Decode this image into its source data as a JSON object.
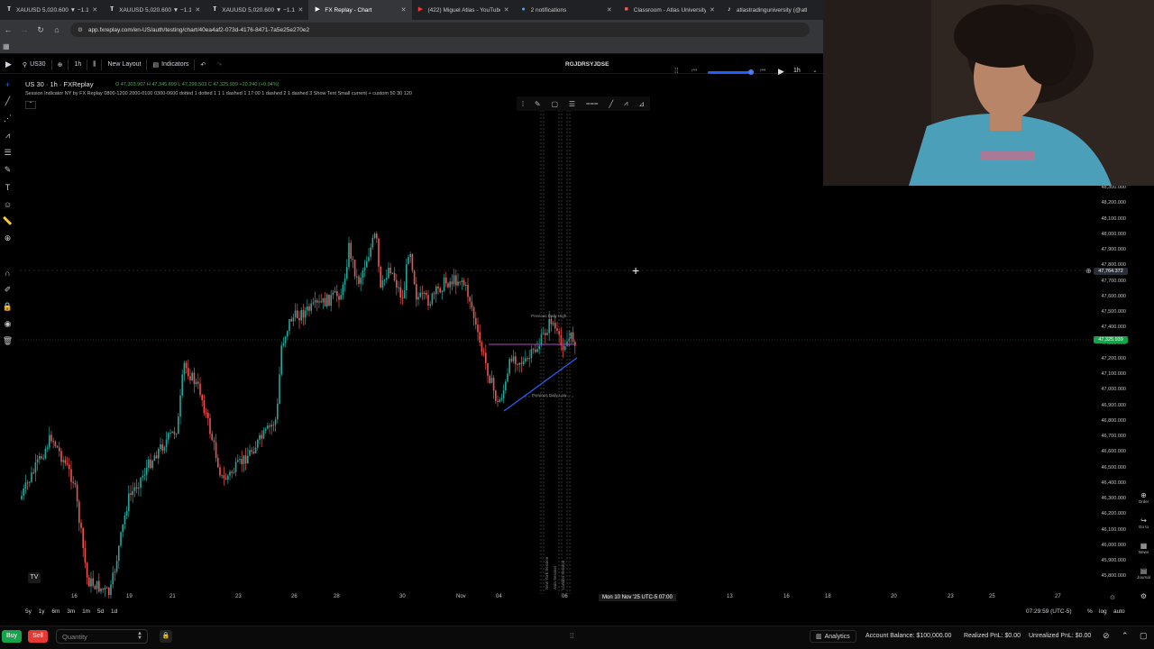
{
  "browser": {
    "tabs": [
      {
        "label": "XAUUSD 5,020.600 ▼ −1.15",
        "favicon": "tradingview-icon",
        "active": false
      },
      {
        "label": "XAUUSD 5,020.600 ▼ −1.15",
        "favicon": "tradingview-icon",
        "active": false
      },
      {
        "label": "XAUUSD 5,020.600 ▼ −1.15",
        "favicon": "tradingview-icon",
        "active": false
      },
      {
        "label": "FX Replay - Chart",
        "favicon": "fxreplay-icon",
        "active": true
      },
      {
        "label": "(422) Miguel Atlas - YouTube",
        "favicon": "youtube-icon",
        "active": false
      },
      {
        "label": "2 notifications",
        "favicon": "notification-icon",
        "active": false
      },
      {
        "label": "Classroom - Atlas University",
        "favicon": "classroom-icon",
        "active": false
      },
      {
        "label": "atlastradinguniversity (@atl",
        "favicon": "tiktok-icon",
        "active": false
      }
    ],
    "url": "app.fxreplay.com/en-US/auth/testing/chart/40ea4af2-073d-4176-8471-7a5e25e270e2"
  },
  "toolbar": {
    "symbol": "US30",
    "timeframe": "1h",
    "new_layout": "New Layout",
    "indicators": "Indicators",
    "center_code": "RGJDRSYJDSE",
    "replay_timeframe": "1h"
  },
  "legend": {
    "title": "US 30 · 1h · FXReplay",
    "ohlc": "O 47,303.907  H 47,345.699  L 47,299.503  C 47,325.939  +20.240 (+0.04%)",
    "indicator": "Session Indicator NY by FX Replay  0800-1200 2000-0100 0300-0600 dotted 1 dotted 1 1 1 dashed 1 17:00 1 dashed 2 1 dashed 3 Show Text Small current + custom 50 30 120"
  },
  "price_axis": {
    "labels": [
      "48,300.000",
      "48,200.000",
      "48,100.000",
      "48,000.000",
      "47,900.000",
      "47,800.000",
      "47,700.000",
      "47,600.000",
      "47,500.000",
      "47,400.000",
      "47,300.000",
      "47,200.000",
      "47,100.000",
      "47,000.000",
      "46,900.000",
      "46,800.000",
      "46,700.000",
      "46,600.000",
      "46,500.000",
      "46,400.000",
      "46,300.000",
      "46,200.000",
      "46,100.000",
      "46,000.000",
      "45,900.000",
      "45,800.000"
    ],
    "crosshair_price": "47,764.372",
    "current_price": "47,325.939"
  },
  "time_axis": {
    "labels": [
      "16",
      "19",
      "21",
      "23",
      "26",
      "28",
      "30",
      "Nov",
      "04",
      "06",
      "13",
      "16",
      "18",
      "20",
      "23",
      "25",
      "27"
    ],
    "crosshair_time": "Mon 10 Nov '25 UTC-5   07:00"
  },
  "chart_annotations": {
    "prev_high": "Previous Daily High",
    "prev_low": "Previous Daily Low",
    "sessions": [
      "New York Session",
      "Asia Session",
      "London Session"
    ]
  },
  "range_bar": {
    "ranges": [
      "5y",
      "1y",
      "6m",
      "3m",
      "1m",
      "5d",
      "1d"
    ],
    "clock": "07:29:59 (UTC-5)",
    "pct": "%",
    "log": "log",
    "auto": "auto"
  },
  "right_bar": [
    "Order",
    "Go to",
    "News",
    "Journal"
  ],
  "trade_bar": {
    "buy": "Buy",
    "sell": "Sell",
    "quantity_placeholder": "Quantity",
    "analytics": "Analytics",
    "account_balance": "Account Balance: $100,000.00",
    "realized": "Realized PnL: $0.00",
    "unrealized": "Unrealized PnL: $0.00"
  },
  "colors": {
    "bull": "#26a69a",
    "bear": "#ef5350",
    "accent": "#2962ff",
    "buy": "#17a34a",
    "sell": "#e53935"
  }
}
